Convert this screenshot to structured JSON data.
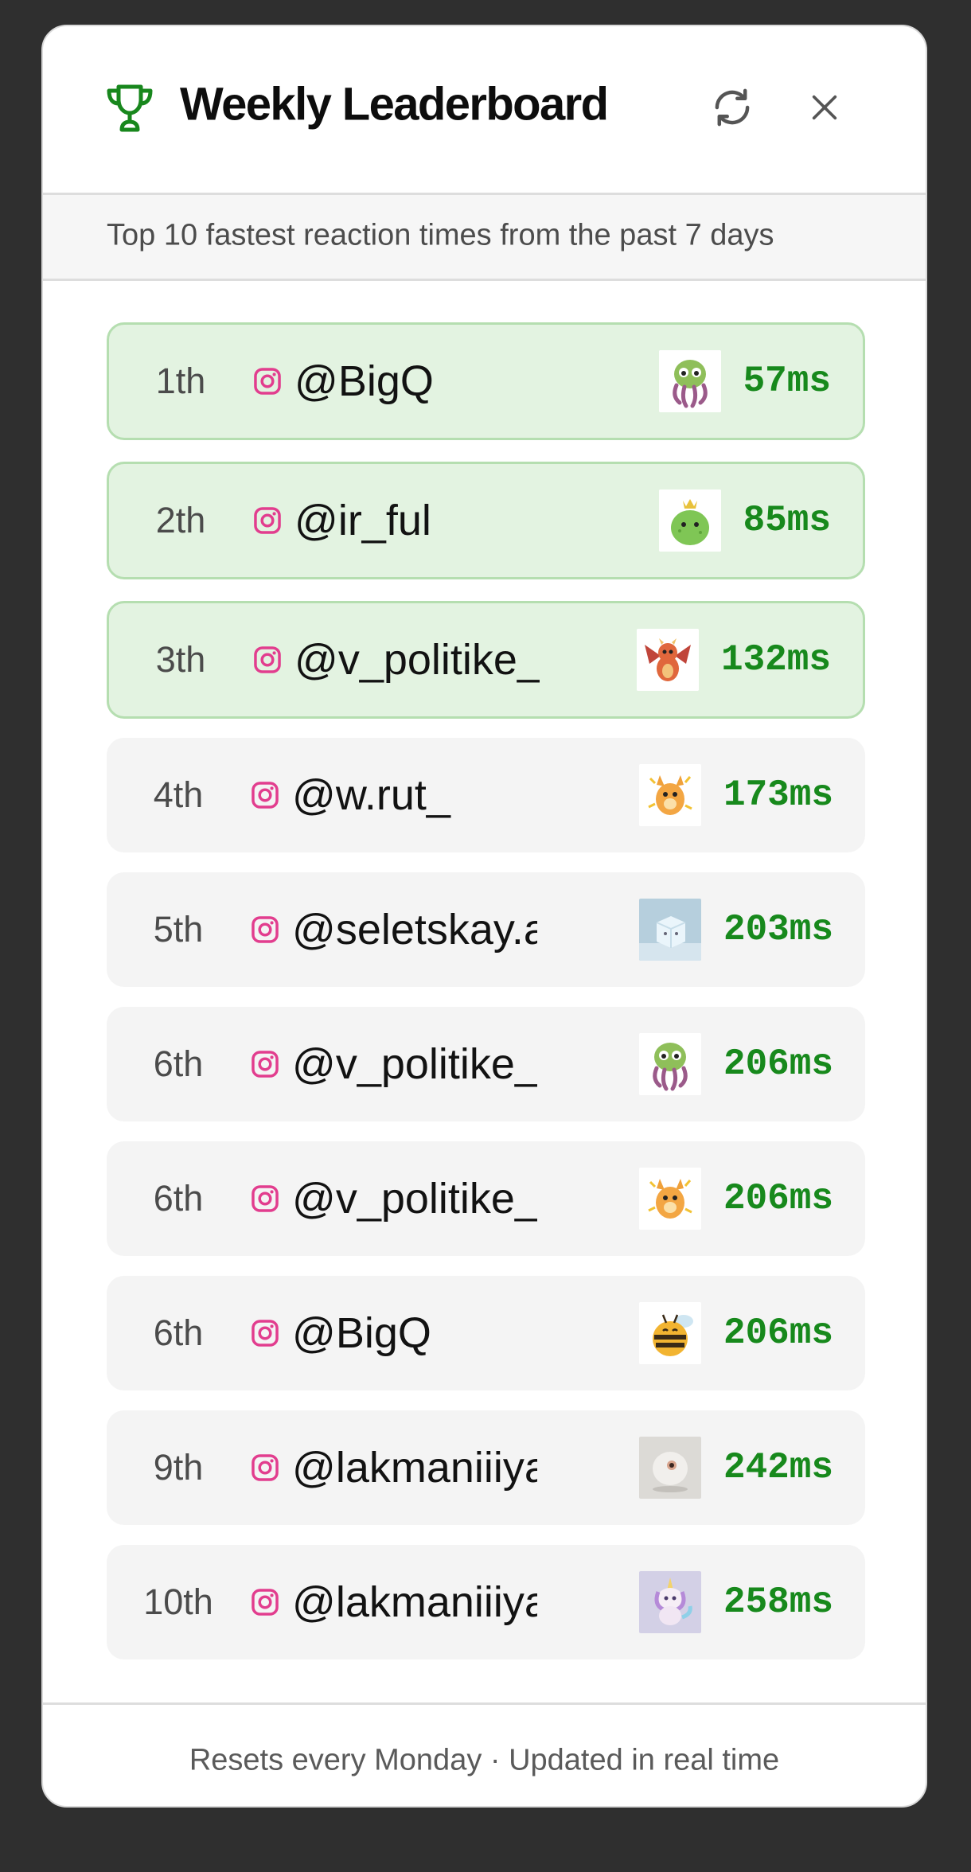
{
  "header": {
    "title": "Weekly Leaderboard",
    "trophy_icon": "trophy-icon",
    "refresh_icon": "refresh-icon",
    "close_icon": "close-icon",
    "accent_color": "#17891c"
  },
  "subtitle": "Top 10 fastest reaction times from the past 7 days",
  "entries": [
    {
      "rank": "1th",
      "handle": "@BigQ",
      "time": "57ms",
      "avatar": "green-octopus",
      "highlight": true
    },
    {
      "rank": "2th",
      "handle": "@ir_ful",
      "time": "85ms",
      "avatar": "green-crowned-blob",
      "highlight": true
    },
    {
      "rank": "3th",
      "handle": "@v_politike_",
      "time": "132ms",
      "avatar": "red-dragon",
      "highlight": true
    },
    {
      "rank": "4th",
      "handle": "@w.rut_",
      "time": "173ms",
      "avatar": "orange-electric-critter",
      "highlight": false
    },
    {
      "rank": "5th",
      "handle": "@seletskay.a",
      "time": "203ms",
      "avatar": "ice-cube",
      "highlight": false
    },
    {
      "rank": "6th",
      "handle": "@v_politike_",
      "time": "206ms",
      "avatar": "green-octopus",
      "highlight": false
    },
    {
      "rank": "6th",
      "handle": "@v_politike_",
      "time": "206ms",
      "avatar": "orange-electric-critter",
      "highlight": false
    },
    {
      "rank": "6th",
      "handle": "@BigQ",
      "time": "206ms",
      "avatar": "bee",
      "highlight": false
    },
    {
      "rank": "9th",
      "handle": "@lakmaniiiya",
      "time": "242ms",
      "avatar": "white-puffball",
      "highlight": false
    },
    {
      "rank": "10th",
      "handle": "@lakmaniiiya",
      "time": "258ms",
      "avatar": "unicorn-cat",
      "highlight": false
    }
  ],
  "footer": "Resets every Monday · Updated in real time"
}
